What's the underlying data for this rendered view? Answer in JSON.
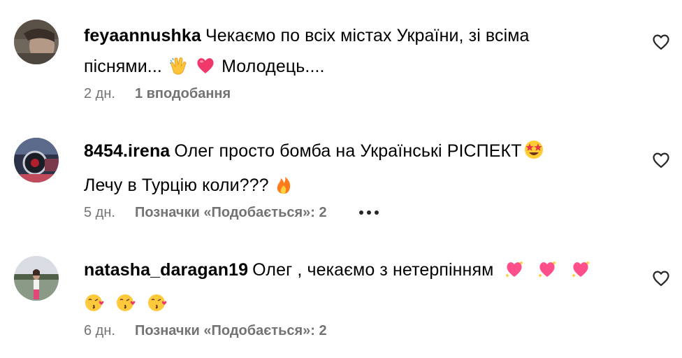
{
  "comments": [
    {
      "username": "feyaannushka",
      "text_part1": "Чекаємо по всіх містах України, зі всіма піснями...",
      "text_part2": "Молодець....",
      "time": "2 дн.",
      "likes": "1 вподобання",
      "avatar_icon": "profile-photo"
    },
    {
      "username": "8454.irena",
      "text_part1": "Олег просто бомба на Українські РІСПЕКТ",
      "text_part2": "Лечу в Турцію коли???",
      "time": "5 дн.",
      "likes": "Позначки «Подобається»: 2",
      "avatar_icon": "profile-photo"
    },
    {
      "username": "natasha_daragan19",
      "text_part1": "Олег , чекаємо з нетерпінням",
      "time": "6 дн.",
      "likes": "Позначки «Подобається»: 2",
      "avatar_icon": "profile-photo"
    }
  ],
  "icons": {
    "like": "heart-outline-icon",
    "more": "more-options-icon",
    "emoji": [
      "clapping-hands",
      "pink-heart",
      "star-struck",
      "fire",
      "sparkling-heart",
      "face-blowing-kiss"
    ]
  },
  "colors": {
    "text": "#000000",
    "secondary": "#737373",
    "accent_heart": "#f0386b"
  }
}
